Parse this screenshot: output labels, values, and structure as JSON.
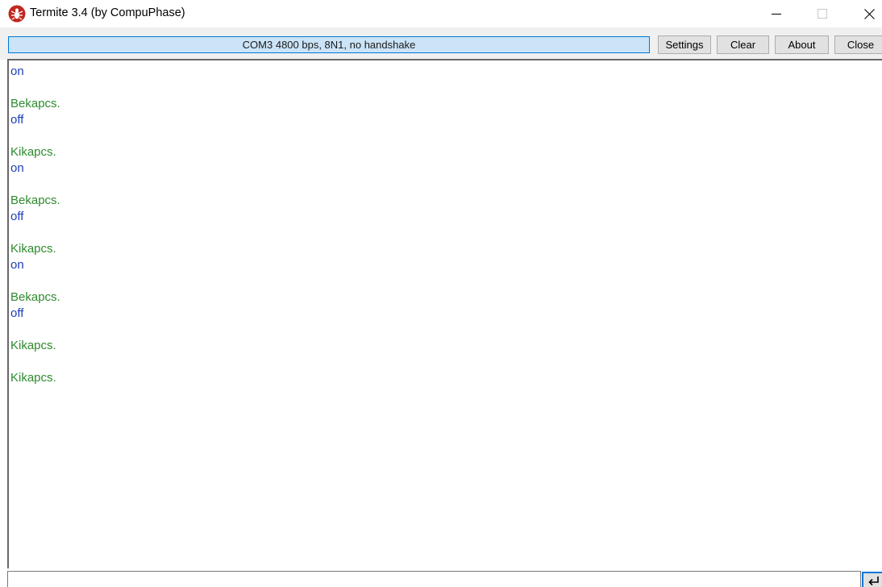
{
  "window": {
    "title": "Termite 3.4 (by CompuPhase)",
    "icons": {
      "app": "termite-bug-icon",
      "minimize": "minimize-icon",
      "maximize": "maximize-icon",
      "close": "close-icon"
    }
  },
  "toolbar": {
    "status": "COM3 4800 bps, 8N1, no handshake",
    "settings_label": "Settings",
    "clear_label": "Clear",
    "about_label": "About",
    "close_label": "Close"
  },
  "output": {
    "lines": [
      {
        "text": "on",
        "kind": "rx"
      },
      {
        "text": "",
        "kind": "blank"
      },
      {
        "text": "Bekapcs.",
        "kind": "tx"
      },
      {
        "text": "off",
        "kind": "rx"
      },
      {
        "text": "",
        "kind": "blank"
      },
      {
        "text": "Kikapcs.",
        "kind": "tx"
      },
      {
        "text": "on",
        "kind": "rx"
      },
      {
        "text": "",
        "kind": "blank"
      },
      {
        "text": "Bekapcs.",
        "kind": "tx"
      },
      {
        "text": "off",
        "kind": "rx"
      },
      {
        "text": "",
        "kind": "blank"
      },
      {
        "text": "Kikapcs.",
        "kind": "tx"
      },
      {
        "text": "on",
        "kind": "rx"
      },
      {
        "text": "",
        "kind": "blank"
      },
      {
        "text": "Bekapcs.",
        "kind": "tx"
      },
      {
        "text": "off",
        "kind": "rx"
      },
      {
        "text": "",
        "kind": "blank"
      },
      {
        "text": "Kikapcs.",
        "kind": "tx"
      },
      {
        "text": "",
        "kind": "blank"
      },
      {
        "text": "Kikapcs.",
        "kind": "tx"
      }
    ]
  },
  "input": {
    "value": "",
    "send_icon": "enter-return-icon"
  },
  "colors": {
    "received": "#1f3fb4",
    "sent": "#2e8b2e",
    "status_bg": "#cce4f7",
    "accent": "#0078d7"
  }
}
